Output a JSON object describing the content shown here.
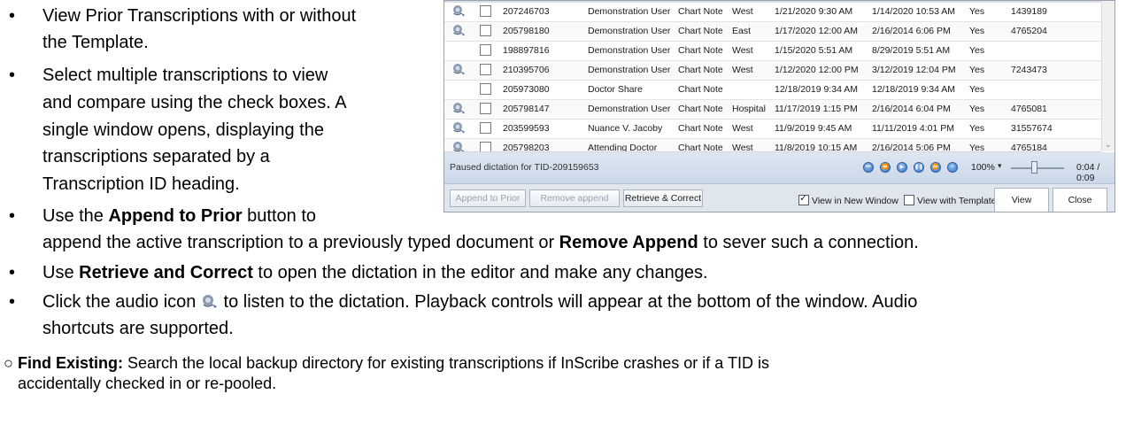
{
  "bullets_left": [
    {
      "lines": [
        "View Prior Transcriptions with or without",
        "the Template."
      ]
    },
    {
      "lines": [
        "Select multiple transcriptions to view",
        "and compare using the check boxes. A",
        "single window opens, displaying the",
        "transcriptions separated by a",
        "Transcription ID heading."
      ]
    }
  ],
  "append_bullet": {
    "prefix": "Use the ",
    "bold1": "Append to Prior",
    "line1_suffix": " button to",
    "line2_prefix": "append the active transcription to a previously typed document or ",
    "bold2": "Remove Append",
    "line2_suffix": " to sever such a connection."
  },
  "retrieve_bullet": {
    "prefix": "Use ",
    "bold": "Retrieve and Correct",
    "suffix": " to open the dictation in the editor and make any changes."
  },
  "audio_bullet": {
    "line1_prefix": "Click the audio icon ",
    "line1_suffix": " to listen to the dictation. Playback controls will appear at the bottom of the window. Audio",
    "line2": "shortcuts are supported."
  },
  "find_existing": {
    "bold": "Find Existing:",
    "line1_suffix": "  Search the local backup directory for existing transcriptions if InScribe crashes or if a TID is",
    "line2": "accidentally checked in or re-pooled."
  },
  "table": {
    "rows": [
      {
        "audio": true,
        "tid": "207246703",
        "user": "Demonstration User",
        "type": "Chart Note",
        "site": "West",
        "dictated": "1/21/2020 9:30 AM",
        "transcribed": "1/14/2020 10:53 AM",
        "flag": "Yes",
        "number": "1439189"
      },
      {
        "audio": true,
        "tid": "205798180",
        "user": "Demonstration User",
        "type": "Chart Note",
        "site": "East",
        "dictated": "1/17/2020 12:00 AM",
        "transcribed": "2/16/2014 6:06 PM",
        "flag": "Yes",
        "number": "4765204"
      },
      {
        "audio": false,
        "tid": "198897816",
        "user": "Demonstration User",
        "type": "Chart Note",
        "site": "West",
        "dictated": "1/15/2020 5:51 AM",
        "transcribed": "8/29/2019 5:51 AM",
        "flag": "Yes",
        "number": ""
      },
      {
        "audio": true,
        "tid": "210395706",
        "user": "Demonstration User",
        "type": "Chart Note",
        "site": "West",
        "dictated": "1/12/2020 12:00 PM",
        "transcribed": "3/12/2019 12:04 PM",
        "flag": "Yes",
        "number": "7243473"
      },
      {
        "audio": false,
        "tid": "205973080",
        "user": "Doctor Share",
        "type": "Chart Note",
        "site": "",
        "dictated": "12/18/2019 9:34 AM",
        "transcribed": "12/18/2019 9:34 AM",
        "flag": "Yes",
        "number": ""
      },
      {
        "audio": true,
        "tid": "205798147",
        "user": "Demonstration User",
        "type": "Chart Note",
        "site": "Hospital",
        "dictated": "11/17/2019 1:15 PM",
        "transcribed": "2/16/2014 6:04 PM",
        "flag": "Yes",
        "number": "4765081"
      },
      {
        "audio": true,
        "tid": "203599593",
        "user": "Nuance V. Jacoby",
        "type": "Chart Note",
        "site": "West",
        "dictated": "11/9/2019 9:45 AM",
        "transcribed": "11/11/2019 4:01 PM",
        "flag": "Yes",
        "number": "31557674"
      },
      {
        "audio": true,
        "tid": "205798203",
        "user": "Attending Doctor",
        "type": "Chart Note",
        "site": "West",
        "dictated": "11/8/2019 10:15 AM",
        "transcribed": "2/16/2014 5:06 PM",
        "flag": "Yes",
        "number": "4765184"
      }
    ]
  },
  "status": {
    "text": "Paused dictation for TID-209159653",
    "zoom": "100%",
    "time": "0:04 / 0:09",
    "playback_fraction": 0.44
  },
  "buttons": {
    "append_to_prior": "Append to Prior",
    "remove_append": "Remove append",
    "retrieve_correct": "Retrieve & Correct",
    "view_new_window": "View in New Window",
    "view_with_template": "View with Template",
    "view": "View",
    "close": "Close"
  },
  "colors": {
    "accent": "#2f6fc0",
    "status_bar": "#dde7f2"
  }
}
